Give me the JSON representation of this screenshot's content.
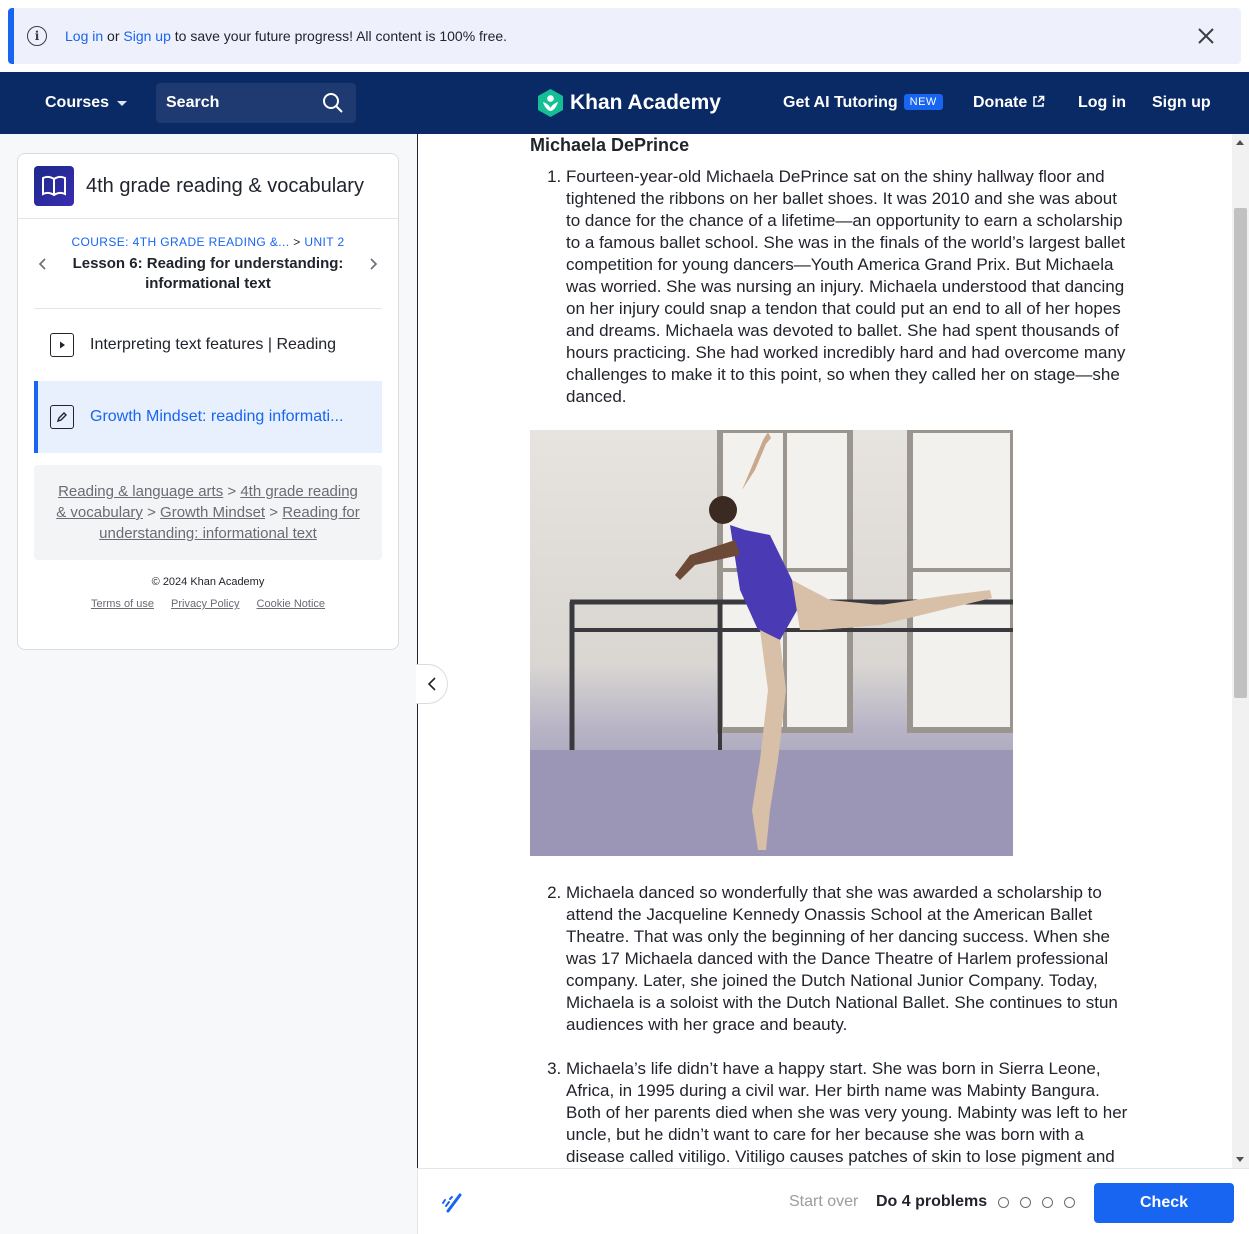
{
  "banner": {
    "login": "Log in",
    "or": "or",
    "signup": "Sign up",
    "message": "to save your future progress! All content is 100% free."
  },
  "header": {
    "courses": "Courses",
    "search": "Search",
    "logo": "Khan Academy",
    "ai_tutoring": "Get AI Tutoring",
    "new_badge": "NEW",
    "donate": "Donate",
    "login": "Log in",
    "signup": "Sign up"
  },
  "sidebar": {
    "course_title": "4th grade reading & vocabulary",
    "crumb_course": "COURSE: 4TH GRADE READING &...",
    "crumb_sep": ">",
    "crumb_unit": "UNIT 2",
    "lesson_title": "Lesson 6: Reading for understanding: informational text",
    "items": [
      {
        "label": "Interpreting text features | Reading"
      },
      {
        "label": "Growth Mindset: reading informati..."
      }
    ],
    "breadcrumbs": [
      "Reading & language arts",
      "4th grade reading & vocabulary",
      "Growth Mindset",
      "Reading for understanding: informational text"
    ],
    "copyright": "© 2024 Khan Academy",
    "footer_links": [
      "Terms of use",
      "Privacy Policy",
      "Cookie Notice"
    ]
  },
  "article": {
    "heading": "Michaela DePrince",
    "paragraphs": [
      "Fourteen-year-old Michaela DePrince sat on the shiny hallway floor and tightened the ribbons on her ballet shoes. It was 2010 and she was about to dance for the chance of a lifetime—an opportunity to earn a scholarship to a famous ballet school. She was in the finals of the world’s largest ballet competition for young dancers—Youth America Grand Prix. But Michaela was worried. She was nursing an injury. Michaela understood that dancing on her injury could snap a tendon that could put an end to all of her hopes and dreams. Michaela was devoted to ballet. She had spent thousands of hours practicing. She had worked incredibly hard and had overcome many challenges to make it to this point, so when they called her on stage—she danced.",
      "Michaela danced so wonderfully that she was awarded a scholarship to attend the Jacqueline Kennedy Onassis School at the American Ballet Theatre. That was only the beginning of her dancing success. When she was 17 Michaela danced with the Dance Theatre of Harlem professional company. Later, she joined the Dutch National Junior Company. Today, Michaela is a soloist with the Dutch National Ballet. She continues to stun audiences with her grace and beauty.",
      "Michaela’s life didn’t have a happy start. She was born in Sierra Leone, Africa, in 1995 during a civil war. Her birth name was Mabinty Bangura. Both of her parents died when she was very young. Mabinty was left to her uncle, but he didn’t want to care for her because she was born with a disease called vitiligo. Vitiligo causes patches of skin to lose pigment and become lighter. Often, vitiligo looks like white spots."
    ]
  },
  "bottom_bar": {
    "start_over": "Start over",
    "problems": "Do 4 problems",
    "check": "Check"
  },
  "colors": {
    "brand_blue": "#1865f2",
    "header_navy": "#0a2a66",
    "logo_green": "#14bf96"
  }
}
